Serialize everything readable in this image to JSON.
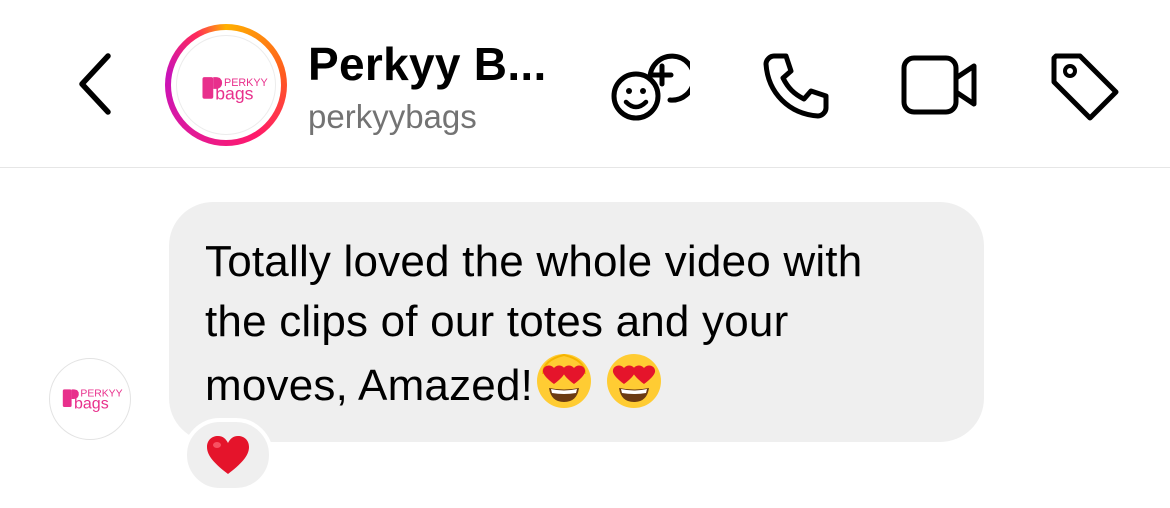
{
  "header": {
    "title": "Perkyy B...",
    "username": "perkyybags",
    "avatar_logo": {
      "top_text": "PERKYY",
      "bottom_text": "bags",
      "brand_color": "#e8308c"
    },
    "icons": [
      "back-chevron-icon",
      "add-to-group-icon",
      "phone-icon",
      "video-call-icon",
      "tag-icon"
    ]
  },
  "messages": [
    {
      "sender": "perkyybags",
      "text": "Totally loved the whole video with\nthe clips of our totes and your\nmoves, Amazed!",
      "emoji": [
        "heart-eyes-emoji",
        "heart-eyes-emoji"
      ],
      "reaction": "red-heart-emoji"
    }
  ],
  "colors": {
    "bubble": "#efefef",
    "subtitle": "#737373",
    "ring_start": "#ffb000",
    "ring_end": "#c913b9",
    "heart": "#e5142b"
  }
}
